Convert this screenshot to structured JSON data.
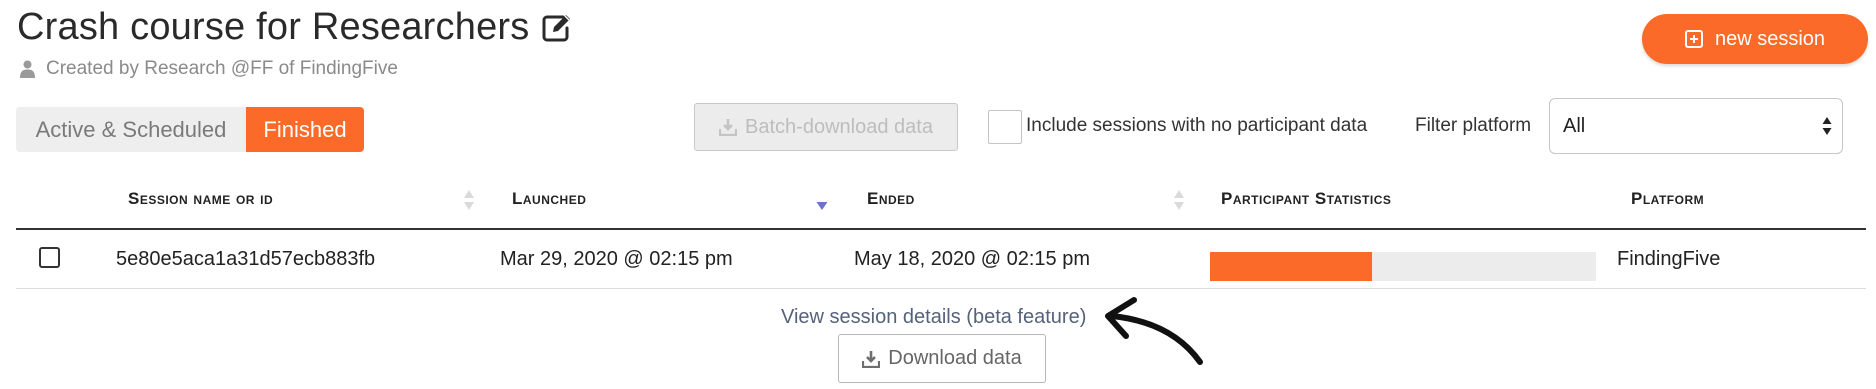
{
  "header": {
    "title": "Crash course for Researchers",
    "creator_text": "Created by Research @FF of FindingFive",
    "new_session_label": "new session"
  },
  "tabs": [
    {
      "label": "Active & Scheduled",
      "selected": false
    },
    {
      "label": "Finished",
      "selected": true
    }
  ],
  "toolbar": {
    "batch_download_label": "Batch-download data",
    "include_no_data_label": "Include sessions with no participant data",
    "include_no_data_checked": false,
    "filter_platform_label": "Filter platform",
    "filter_platform_value": "All"
  },
  "table": {
    "columns": [
      {
        "label": "Session name or id",
        "sortable": true
      },
      {
        "label": "Launched",
        "sortable": true,
        "sorted": "descending"
      },
      {
        "label": "Ended",
        "sortable": true
      },
      {
        "label": "Participant Statistics",
        "sortable": false
      },
      {
        "label": "Platform",
        "sortable": false
      }
    ],
    "rows": [
      {
        "session_id": "5e80e5aca1a31d57ecb883fb",
        "launched": "Mar 29, 2020 @ 02:15 pm",
        "ended": "May 18, 2020 @ 02:15 pm",
        "participant_fraction": 0.42,
        "platform": "FindingFive"
      }
    ]
  },
  "footer": {
    "details_link": "View session details (beta feature)",
    "download_label": "Download data"
  },
  "colors": {
    "accent": "#fb6a28",
    "sort_active": "#6a72c9",
    "link": "#55627a"
  },
  "icons": {
    "edit": "pencil-square-icon",
    "user": "user-icon",
    "add": "plus-square-icon",
    "download": "download-icon",
    "annotation": "curved-arrow-icon"
  }
}
